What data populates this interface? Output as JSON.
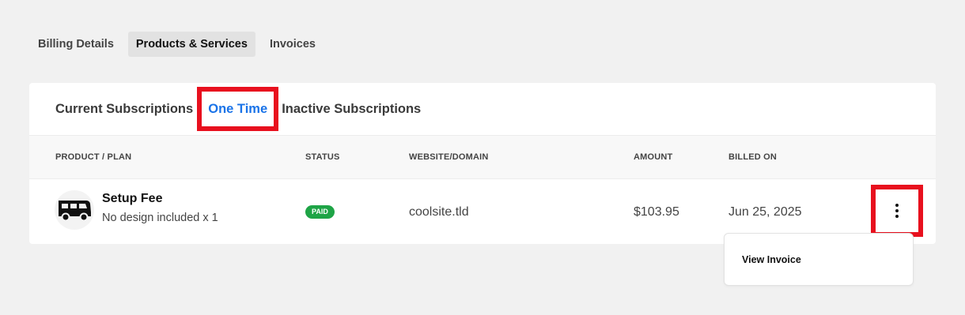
{
  "top_tabs": [
    {
      "label": "Billing Details",
      "active": false
    },
    {
      "label": "Products & Services",
      "active": true
    },
    {
      "label": "Invoices",
      "active": false
    }
  ],
  "sub_tabs": [
    {
      "label": "Current Subscriptions",
      "active": false
    },
    {
      "label": "One Time",
      "active": true
    },
    {
      "label": "Inactive Subscriptions",
      "active": false
    }
  ],
  "table": {
    "headers": {
      "product": "PRODUCT / PLAN",
      "status": "STATUS",
      "website": "WEBSITE/DOMAIN",
      "amount": "AMOUNT",
      "billed_on": "BILLED ON"
    },
    "rows": [
      {
        "icon": "van-icon",
        "product_name": "Setup Fee",
        "product_desc": "No design included x 1",
        "status": "PAID",
        "website": "coolsite.tld",
        "amount": "$103.95",
        "billed_on": "Jun 25, 2025"
      }
    ]
  },
  "dropdown": {
    "items": [
      {
        "label": "View Invoice"
      }
    ]
  },
  "colors": {
    "accent": "#1a73e8",
    "paid": "#1ea446",
    "highlight": "#e8101e"
  }
}
